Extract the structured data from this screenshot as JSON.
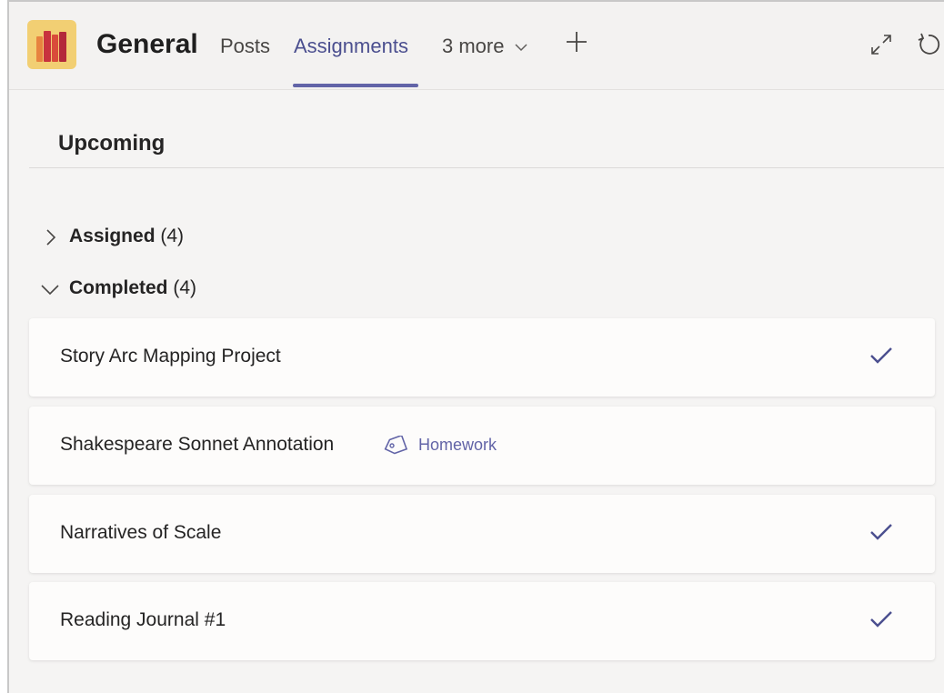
{
  "header": {
    "team_name": "General",
    "tabs": [
      {
        "label": "Posts"
      },
      {
        "label": "Assignments"
      },
      {
        "label": "3 more"
      }
    ],
    "active_tab": "Assignments",
    "accent": "#6264a7"
  },
  "main": {
    "section_title": "Upcoming",
    "groups": [
      {
        "label": "Assigned",
        "count": "(4)",
        "expanded": false
      },
      {
        "label": "Completed",
        "count": "(4)",
        "expanded": true
      }
    ],
    "items": [
      {
        "title": "Story Arc Mapping Project",
        "tag": "",
        "completed": true
      },
      {
        "title": "Shakespeare Sonnet Annotation",
        "tag": "Homework",
        "completed": false
      },
      {
        "title": "Narratives of Scale",
        "tag": "",
        "completed": true
      },
      {
        "title": "Reading Journal #1",
        "tag": "",
        "completed": true
      }
    ]
  },
  "icons": {
    "app": "books-icon",
    "more": "chevron-down-icon",
    "add": "plus-icon",
    "expand": "expand-icon",
    "refresh": "refresh-icon",
    "check": "checkmark-icon",
    "tag": "tag-icon"
  }
}
